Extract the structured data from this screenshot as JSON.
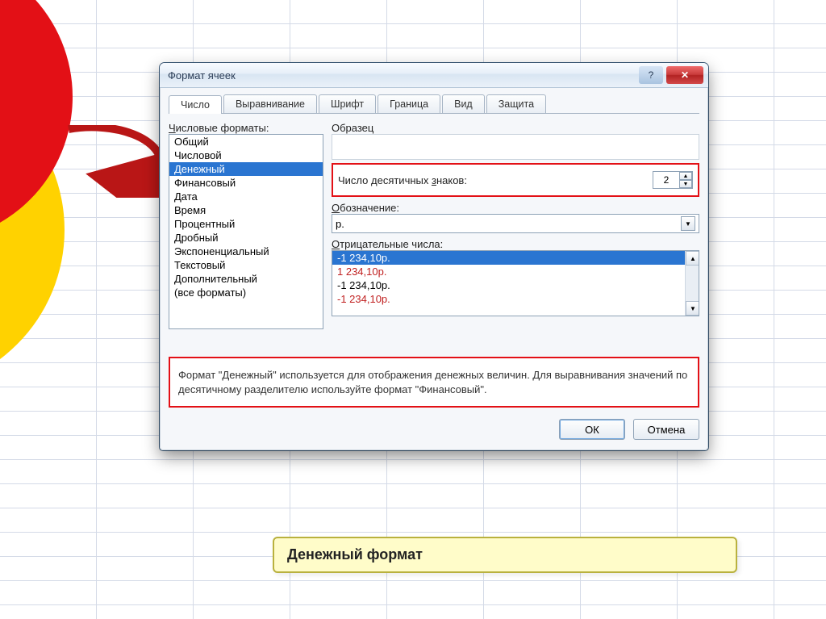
{
  "dialog": {
    "title": "Формат ячеек",
    "tabs": [
      "Число",
      "Выравнивание",
      "Шрифт",
      "Граница",
      "Вид",
      "Защита"
    ],
    "active_tab": 0,
    "categories_label": "Числовые форматы:",
    "categories": [
      "Общий",
      "Числовой",
      "Денежный",
      "Финансовый",
      "Дата",
      "Время",
      "Процентный",
      "Дробный",
      "Экспоненциальный",
      "Текстовый",
      "Дополнительный",
      "(все форматы)"
    ],
    "selected_category_index": 2,
    "sample_label": "Образец",
    "decimals_label_pre": "Число десятичных ",
    "decimals_label_u": "з",
    "decimals_label_post": "наков:",
    "decimals_value": "2",
    "symbol_label_pre": "",
    "symbol_label_u": "О",
    "symbol_label_post": "бозначение:",
    "symbol_value": "р.",
    "negatives_label_pre": "",
    "negatives_label_u": "О",
    "negatives_label_post": "трицательные числа:",
    "negatives": [
      {
        "text": "-1 234,10р.",
        "selected": true,
        "red": false
      },
      {
        "text": "1 234,10р.",
        "selected": false,
        "red": true
      },
      {
        "text": "-1 234,10р.",
        "selected": false,
        "red": false
      },
      {
        "text": "-1 234,10р.",
        "selected": false,
        "red": true
      }
    ],
    "description": "Формат \"Денежный\" используется для отображения денежных величин. Для выравнивания значений по десятичному разделителю используйте формат \"Финансовый\".",
    "ok": "ОК",
    "cancel": "Отмена",
    "help_glyph": "?",
    "close_glyph": "✕"
  },
  "caption": "Денежный формат"
}
